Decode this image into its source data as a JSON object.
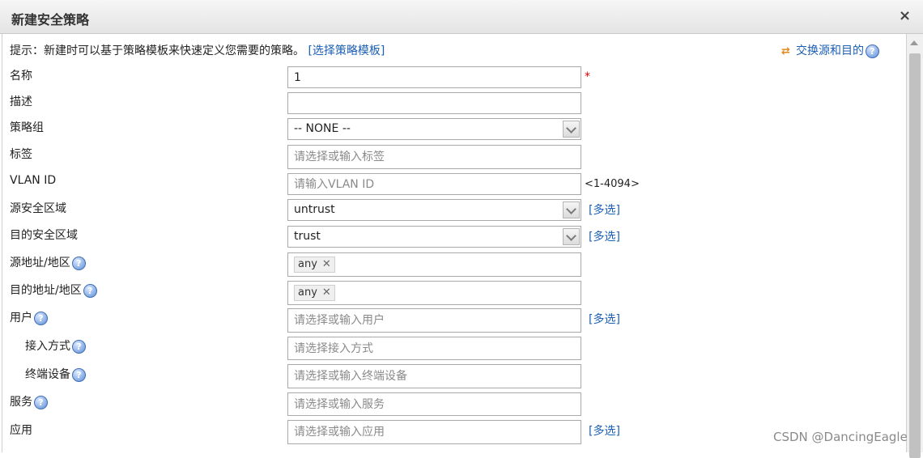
{
  "dialog": {
    "title": "新建安全策略",
    "close_glyph": "×"
  },
  "hint": {
    "text": "提示：新建时可以基于策略模板来快速定义您需要的策略。",
    "link": "[选择策略模板]",
    "swap_label": "交换源和目的"
  },
  "help_glyph": "?",
  "required_mark": "*",
  "form": {
    "name": {
      "label": "名称",
      "value": "1"
    },
    "description": {
      "label": "描述",
      "value": ""
    },
    "policy_group": {
      "label": "策略组",
      "value": "-- NONE --"
    },
    "tag": {
      "label": "标签",
      "placeholder": "请选择或输入标签"
    },
    "vlan": {
      "label": "VLAN ID",
      "placeholder": "请输入VLAN ID",
      "range": "<1-4094>"
    },
    "src_zone": {
      "label": "源安全区域",
      "value": "untrust",
      "multi": "[多选]"
    },
    "dst_zone": {
      "label": "目的安全区域",
      "value": "trust",
      "multi": "[多选]"
    },
    "src_addr": {
      "label": "源地址/地区",
      "tag": "any"
    },
    "dst_addr": {
      "label": "目的地址/地区",
      "tag": "any"
    },
    "user": {
      "label": "用户",
      "placeholder": "请选择或输入用户",
      "multi": "[多选]"
    },
    "access_mode": {
      "label": "接入方式",
      "placeholder": "请选择接入方式"
    },
    "terminal_device": {
      "label": "终端设备",
      "placeholder": "请选择或输入终端设备"
    },
    "service": {
      "label": "服务",
      "placeholder": "请选择或输入服务"
    },
    "application": {
      "label": "应用",
      "placeholder": "请选择或输入应用",
      "multi": "[多选]"
    }
  },
  "tag_remove_glyph": "✕",
  "watermark": "CSDN @DancingEagle"
}
